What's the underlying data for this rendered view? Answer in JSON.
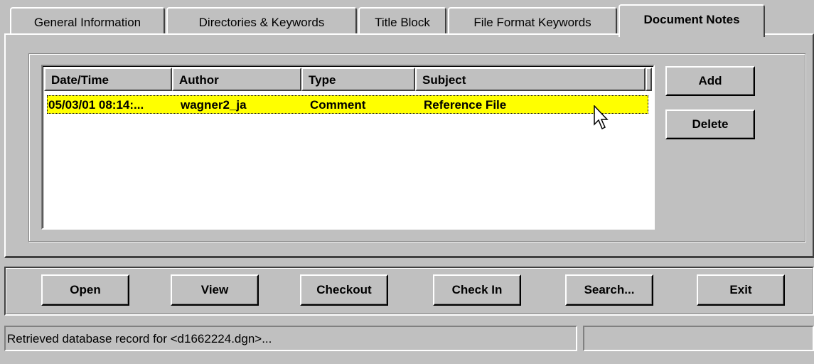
{
  "tabs": [
    {
      "label": "General Information",
      "active": false
    },
    {
      "label": "Directories & Keywords",
      "active": false
    },
    {
      "label": "Title Block",
      "active": false
    },
    {
      "label": "File Format Keywords",
      "active": false
    },
    {
      "label": "Document Notes",
      "active": true
    }
  ],
  "notes_list": {
    "columns": [
      "Date/Time",
      "Author",
      "Type",
      "Subject"
    ],
    "rows": [
      {
        "datetime": "05/03/01 08:14:...",
        "author": "wagner2_ja",
        "type": "Comment",
        "subject": "Reference File",
        "selected": true
      }
    ],
    "selected_color": "#ffff00"
  },
  "side_buttons": {
    "add": "Add",
    "delete": "Delete"
  },
  "toolbar": {
    "open": "Open",
    "view": "View",
    "checkout": "Checkout",
    "checkin": "Check In",
    "search": "Search...",
    "exit": "Exit"
  },
  "status": {
    "message": "Retrieved database record for <d1662224.dgn>...",
    "secondary": ""
  },
  "colors": {
    "window_bg": "#c0c0c0",
    "highlight": "#ffff00"
  }
}
